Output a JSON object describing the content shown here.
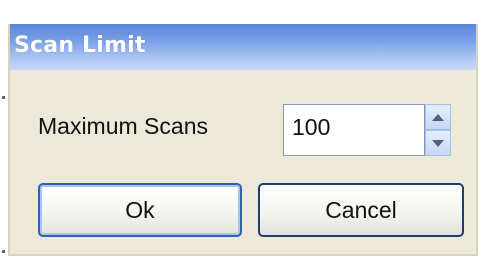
{
  "dialog": {
    "title": "Scan Limit",
    "field_label": "Maximum Scans",
    "field_value": "100",
    "ok_label": "Ok",
    "cancel_label": "Cancel"
  },
  "icons": {
    "spin_up": "chevron-up-icon",
    "spin_down": "chevron-down-icon"
  },
  "colors": {
    "title_bar": "#7aa2ea",
    "dialog_bg": "#ece9d8",
    "ok_focus_border": "#2c5fb8"
  }
}
